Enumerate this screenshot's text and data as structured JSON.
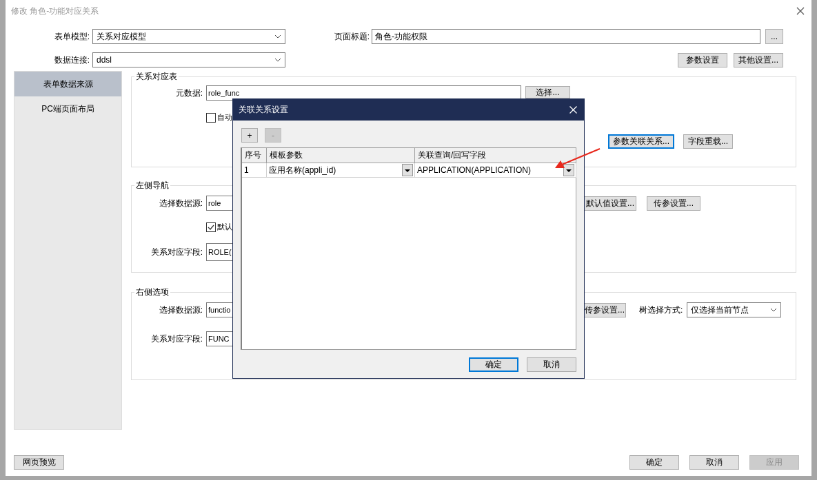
{
  "window": {
    "title": "修改 角色-功能对应关系"
  },
  "form": {
    "model": {
      "label": "表单模型:",
      "value": "关系对应模型"
    },
    "connection": {
      "label": "数据连接:",
      "value": "ddsl"
    },
    "page_title": {
      "label": "页面标题:",
      "value": "角色-功能权限",
      "button": "..."
    }
  },
  "toolbar_buttons": [
    "参数设置",
    "其他设置..."
  ],
  "sidebar": {
    "items": [
      {
        "label": "表单数据来源",
        "selected": true
      },
      {
        "label": "PC端页面布局",
        "selected": false
      }
    ]
  },
  "relation_table": {
    "title": "关系对应表",
    "metadata_label": "元数据:",
    "metadata_value": "role_func",
    "select_button": "选择...",
    "auto_checkbox": {
      "label": "自动",
      "checked": false
    },
    "buttons": [
      {
        "label": "参数关联关系...",
        "focused": true
      },
      {
        "label": "字段重载...",
        "focused": false
      }
    ]
  },
  "left_nav": {
    "title": "左侧导航",
    "source_label": "选择数据源:",
    "source_value": "role",
    "buttons": [
      "默认值设置...",
      "传参设置..."
    ],
    "default_checkbox": {
      "label": "默认",
      "checked": true
    },
    "field_label": "关系对应字段:",
    "field_value": "ROLE("
  },
  "right_options": {
    "title": "右侧选项",
    "source_label": "选择数据源:",
    "source_value": "functio",
    "button": "传参设置...",
    "tree_mode_label": "树选择方式:",
    "tree_mode_value": "仅选择当前节点",
    "field_label": "关系对应字段:",
    "field_value": "FUNC"
  },
  "footer": {
    "preview_button": "网页预览",
    "buttons": [
      {
        "label": "确定",
        "disabled": false
      },
      {
        "label": "取消",
        "disabled": false
      },
      {
        "label": "应用",
        "disabled": true
      }
    ]
  },
  "dialog": {
    "title": "关联关系设置",
    "tool_buttons": [
      {
        "label": "+",
        "disabled": false
      },
      {
        "label": "-",
        "disabled": true
      }
    ],
    "columns": [
      "序号",
      "模板参数",
      "关联查询/回写字段"
    ],
    "rows": [
      {
        "index": "1",
        "param": "应用名称(appli_id)",
        "field": "APPLICATION(APPLICATION)"
      }
    ],
    "buttons": [
      {
        "label": "确定",
        "focused": true
      },
      {
        "label": "取消",
        "focused": false
      }
    ]
  }
}
